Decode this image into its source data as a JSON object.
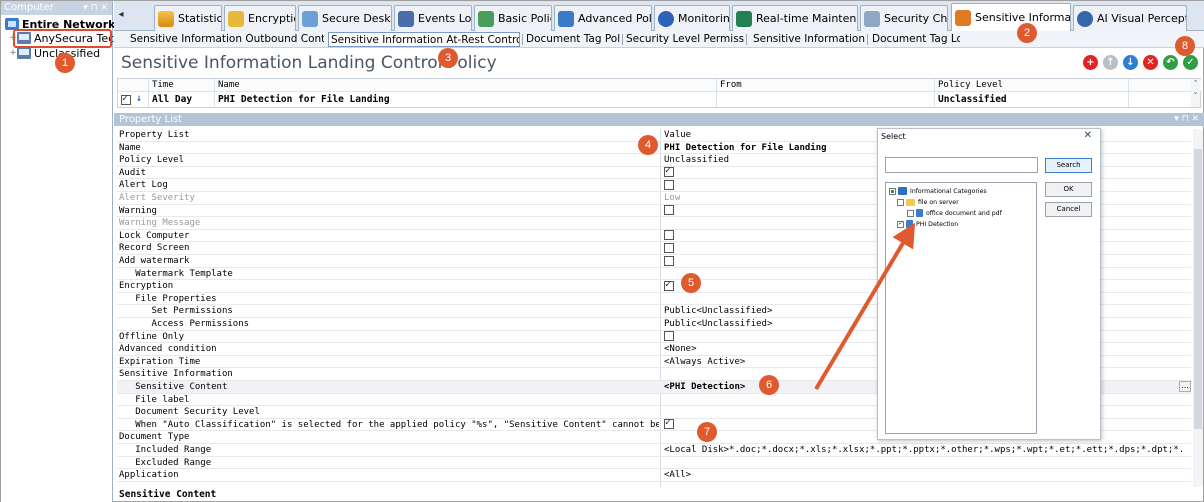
{
  "left_panel": {
    "title": "Computer",
    "controls": "▾ ⊓ ✕",
    "tree": [
      {
        "label": "Entire Network",
        "level": 0
      },
      {
        "label": "AnySecura Tech",
        "level": 1
      },
      {
        "label": "Unclassified",
        "level": 1
      }
    ]
  },
  "tabs": {
    "scroll_left": "◂",
    "items": [
      {
        "label": "Statistics"
      },
      {
        "label": "Encryption"
      },
      {
        "label": "Secure Desktop"
      },
      {
        "label": "Events Log"
      },
      {
        "label": "Basic Policy"
      },
      {
        "label": "Advanced Policy"
      },
      {
        "label": "Monitoring"
      },
      {
        "label": "Real-time Maintenance"
      },
      {
        "label": "Security Check"
      },
      {
        "label": "Sensitive Information"
      },
      {
        "label": "AI Visual Perception"
      }
    ],
    "active": "Sensitive Information"
  },
  "subtabs": [
    {
      "label": "Sensitive Information Outbound Control Policy"
    },
    {
      "label": "Sensitive Information At-Rest Control Policy"
    },
    {
      "label": "Document Tag Policy"
    },
    {
      "label": "Security Level Permissions"
    },
    {
      "label": "Sensitive Information Log"
    },
    {
      "label": "Document Tag Log"
    }
  ],
  "policy": {
    "title": "Sensitive Information Landing Control Policy",
    "buttons": {
      "add": "+",
      "up": "↑",
      "down": "↓",
      "delete": "✕",
      "undo": "↶",
      "save": "✓"
    },
    "columns": [
      "Time",
      "Name",
      "From",
      "Policy Level"
    ],
    "row": {
      "time": "All Day",
      "name": "PHI Detection for File Landing",
      "from": "",
      "level": "Unclassified",
      "checked": true,
      "arrow": "↓"
    }
  },
  "property_list": {
    "title": "Property List",
    "controls": "▾ ⊓ ✕",
    "header": {
      "name": "Property List",
      "value": "Value"
    },
    "rows": [
      {
        "name": "Name",
        "value": "PHI Detection for File Landing",
        "bold": true
      },
      {
        "name": "Policy Level",
        "value": "Unclassified"
      },
      {
        "name": "Audit",
        "check": true
      },
      {
        "name": "Alert Log",
        "check": false
      },
      {
        "name": "Alert Severity",
        "value": "Low",
        "disabled": true
      },
      {
        "name": "Warning",
        "check": false
      },
      {
        "name": "Warning Message",
        "value": "",
        "disabled": true
      },
      {
        "name": "Lock Computer",
        "check": false
      },
      {
        "name": "Record Screen",
        "check": false
      },
      {
        "name": "Add watermark",
        "check": false
      },
      {
        "name": "   Watermark Template",
        "value": ""
      },
      {
        "name": "Encryption",
        "check": true
      },
      {
        "name": "   File Properties",
        "value": ""
      },
      {
        "name": "      Set Permissions",
        "value": "Public<Unclassified>"
      },
      {
        "name": "      Access Permissions",
        "value": "Public<Unclassified>"
      },
      {
        "name": "Offline Only",
        "check": false
      },
      {
        "name": "Advanced condition",
        "value": "<None>"
      },
      {
        "name": "Expiration Time",
        "value": "<Always Active>"
      },
      {
        "name": "Sensitive Information",
        "value": ""
      },
      {
        "name": "   Sensitive Content",
        "value": "<PHI Detection>",
        "bold": true,
        "highlight": true
      },
      {
        "name": "   File label",
        "value": ""
      },
      {
        "name": "   Document Security Level",
        "value": ""
      },
      {
        "name": "   When \"Auto Classification\" is selected for the applied policy \"%s\", \"Sensitive Content\" cannot be empty.This...",
        "check": true
      },
      {
        "name": "Document Type",
        "value": ""
      },
      {
        "name": "   Included Range",
        "value": "<Local Disk>*.doc;*.docx;*.xls;*.xlsx;*.ppt;*.pptx;*.other;*.wps;*.wpt;*.et;*.ett;*.dps;*.dpt;*.other;*.pdf;..."
      },
      {
        "name": "   Excluded Range",
        "value": ""
      },
      {
        "name": "Application",
        "value": "<All>"
      }
    ],
    "ellipsis": "...",
    "footer_label": "Sensitive Content"
  },
  "select_dialog": {
    "title": "Select",
    "close": "✕",
    "search_label": "Search",
    "ok_label": "OK",
    "cancel_label": "Cancel",
    "tree": [
      {
        "label": "Informational Categories",
        "level": 0
      },
      {
        "label": "file on server",
        "level": 1
      },
      {
        "label": "office document and pdf",
        "level": 2
      },
      {
        "label": "PHI Detection",
        "level": 1
      }
    ]
  },
  "markers": [
    "1",
    "2",
    "3",
    "4",
    "5",
    "6",
    "7",
    "8"
  ],
  "colors": {
    "marker": "#e05a30",
    "highlight_box": "#e34a2b",
    "arrow": "#e05a30"
  }
}
